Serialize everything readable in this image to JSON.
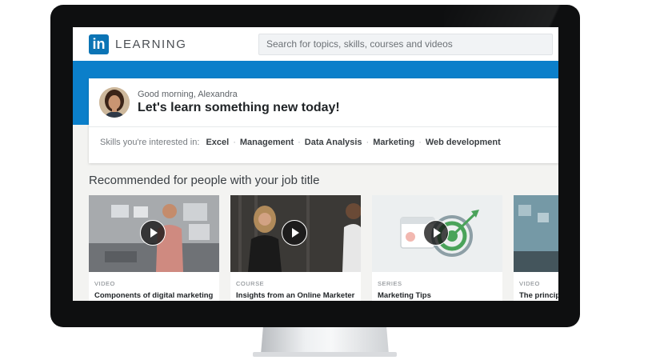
{
  "app": {
    "brand_logo": "in",
    "brand_name": "LEARNING",
    "accent_color": "#0b7fca"
  },
  "search": {
    "placeholder": "Search for topics, skills, courses and videos"
  },
  "welcome": {
    "greeting": "Good morning, Alexandra",
    "tagline": "Let's learn something new today!",
    "skills_label": "Skills you're interested in:",
    "skills": [
      "Excel",
      "Management",
      "Data Analysis",
      "Marketing",
      "Web development"
    ]
  },
  "recommended": {
    "title": "Recommended for people with your job title",
    "items": [
      {
        "type": "VIDEO",
        "title": "Components of digital marketing",
        "icon": "play-icon"
      },
      {
        "type": "COURSE",
        "title": "Insights from an Online Marketer",
        "icon": "play-icon"
      },
      {
        "type": "SERIES",
        "title": "Marketing Tips",
        "icon": "play-icon"
      },
      {
        "type": "VIDEO",
        "title": "The principl",
        "icon": "none"
      }
    ]
  }
}
